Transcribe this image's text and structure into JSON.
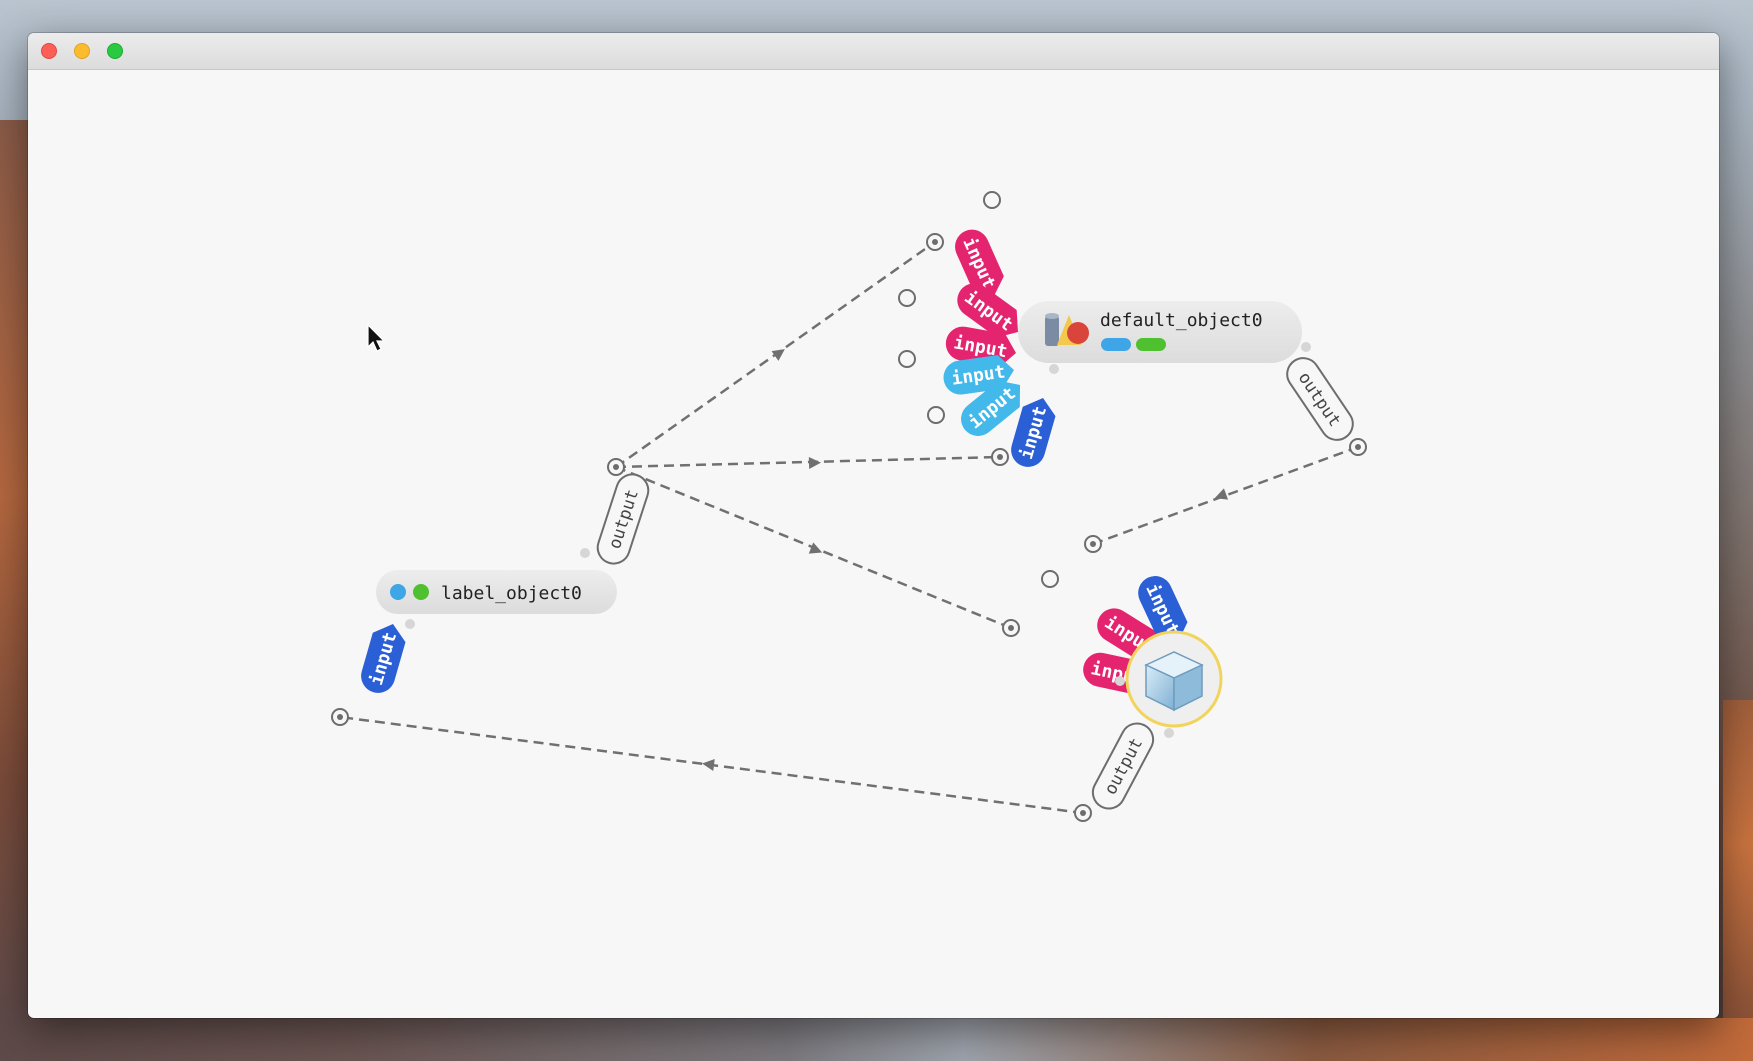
{
  "window": {
    "controls": {
      "close": "close",
      "minimize": "minimize",
      "zoom": "zoom"
    }
  },
  "colors": {
    "pink": "#e5246f",
    "light_blue": "#43b8ea",
    "dark_blue": "#2a5fd6",
    "status_blue": "#3ea6e6",
    "status_green": "#4fc02f",
    "node_bg": "#e6e6e6",
    "selection_ring": "#f2d45c",
    "link": "#707070"
  },
  "nodes": {
    "default_object": {
      "label": "default_object0",
      "icon": "shapes-icon",
      "inlets": [
        {
          "label": "input",
          "color": "pink"
        },
        {
          "label": "input",
          "color": "pink"
        },
        {
          "label": "input",
          "color": "pink"
        },
        {
          "label": "input",
          "color": "light_blue"
        },
        {
          "label": "input",
          "color": "light_blue"
        },
        {
          "label": "input",
          "color": "dark_blue"
        }
      ],
      "outlet": {
        "label": "output"
      }
    },
    "label_object": {
      "label": "label_object0",
      "inlet": {
        "label": "input",
        "color": "dark_blue"
      },
      "outlet": {
        "label": "output"
      }
    },
    "cube_object": {
      "icon": "cube-icon",
      "inlets": [
        {
          "label": "input",
          "color": "pink"
        },
        {
          "label": "input",
          "color": "pink"
        },
        {
          "label": "input",
          "color": "dark_blue"
        }
      ],
      "outlet": {
        "label": "output"
      }
    }
  }
}
